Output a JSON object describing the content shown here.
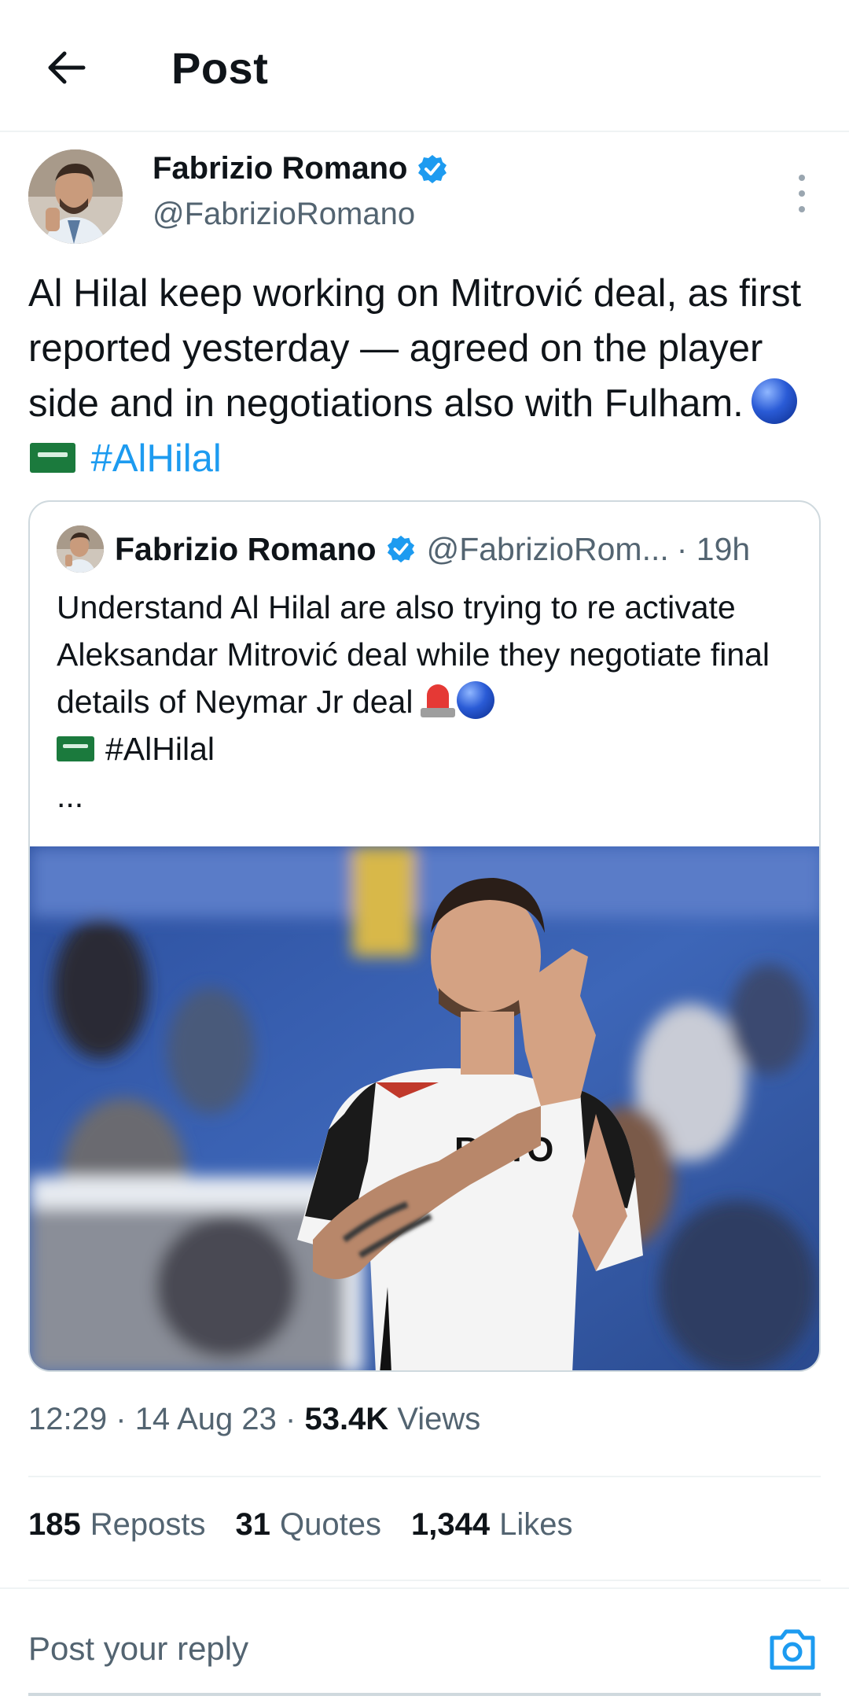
{
  "header": {
    "title": "Post"
  },
  "author": {
    "name": "Fabrizio Romano",
    "handle": "@FabrizioRomano",
    "verified": true
  },
  "tweet": {
    "text_before": "Al Hilal keep working on Mitrović deal, as first reported yesterday — agreed on the player side and in negotiations also with Fulham.",
    "hashtag": "#AlHilal",
    "emojis": [
      "blue-circle",
      "saudi-flag"
    ]
  },
  "quote": {
    "name": "Fabrizio Romano",
    "handle": "@FabrizioRom...",
    "time": "· 19h",
    "text": "Understand Al Hilal are also trying to re activate Aleksandar Mitrović deal while they negotiate final details of Neymar Jr deal",
    "hashtag": "#AlHilal",
    "ellipsis": "...",
    "emojis": [
      "siren",
      "blue-circle",
      "saudi-flag"
    ]
  },
  "meta": {
    "time": "12:29",
    "sep1": "·",
    "date": "14 Aug 23",
    "sep2": "·",
    "views_count": "53.4K",
    "views_label": "Views"
  },
  "stats": {
    "reposts_count": "185",
    "reposts_label": "Reposts",
    "quotes_count": "31",
    "quotes_label": "Quotes",
    "likes_count": "1,344",
    "likes_label": "Likes"
  },
  "reply": {
    "placeholder": "Post your reply"
  },
  "colors": {
    "accent": "#1d9bf0",
    "text": "#0f1419",
    "secondary": "#536471",
    "border": "#cfd9de"
  }
}
